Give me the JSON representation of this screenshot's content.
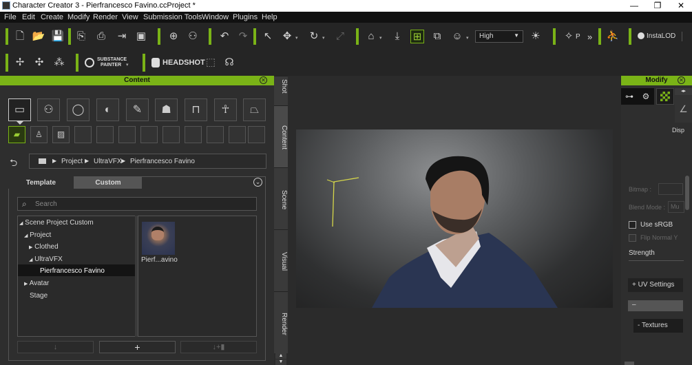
{
  "window": {
    "title": "Character Creator 3 - Pierfrancesco Favino.ccProject *",
    "min": "—",
    "max": "❐",
    "close": "✕"
  },
  "menu": [
    "File",
    "Edit",
    "Create",
    "Modify",
    "Render",
    "View",
    "Submission Tools",
    "Window",
    "Plugins",
    "Help"
  ],
  "toolbar": {
    "quality": "High",
    "p_label": "P",
    "insta_label": "InstaLOD",
    "more": "»"
  },
  "toolbar2": {
    "substance_top": "SUBSTANCE",
    "substance_bottom": "PAINTER",
    "headshot": "HEADSHOT"
  },
  "content": {
    "title": "Content",
    "breadcrumb": [
      "Project",
      "UltraVFX",
      "Pierfrancesco Favino"
    ],
    "tabs": [
      "Template",
      "Custom"
    ],
    "search_placeholder": "Search",
    "tree": [
      {
        "label": "Scene Project Custom",
        "prefix": "◢"
      },
      {
        "label": "Project",
        "prefix": "◢"
      },
      {
        "label": "Clothed",
        "prefix": "▶"
      },
      {
        "label": "UltraVFX",
        "prefix": "◢"
      },
      {
        "label": "Pierfrancesco Favino",
        "prefix": ""
      },
      {
        "label": "Avatar",
        "prefix": "▶"
      },
      {
        "label": "Stage",
        "prefix": ""
      }
    ],
    "thumbnail_label": "Pierf...avino",
    "bottom_buttons": [
      "↓",
      "+",
      "↓+▮"
    ]
  },
  "side_tabs": [
    "Shot",
    "Content",
    "Scene",
    "Visual",
    "Render"
  ],
  "modify": {
    "title": "Modify",
    "disp": "Disp",
    "bitmap": "Bitmap :",
    "blend_mode": "Blend Mode :",
    "blend_value": "Mu",
    "use_srgb": "Use sRGB",
    "flip_normal": "Flip Normal Y",
    "strength": "Strength",
    "uv_settings": "UV Settings",
    "uv_prefix": "+",
    "dash": "–",
    "textures": "Textures",
    "textures_prefix": "-"
  },
  "colors": {
    "accent": "#7ab317"
  }
}
